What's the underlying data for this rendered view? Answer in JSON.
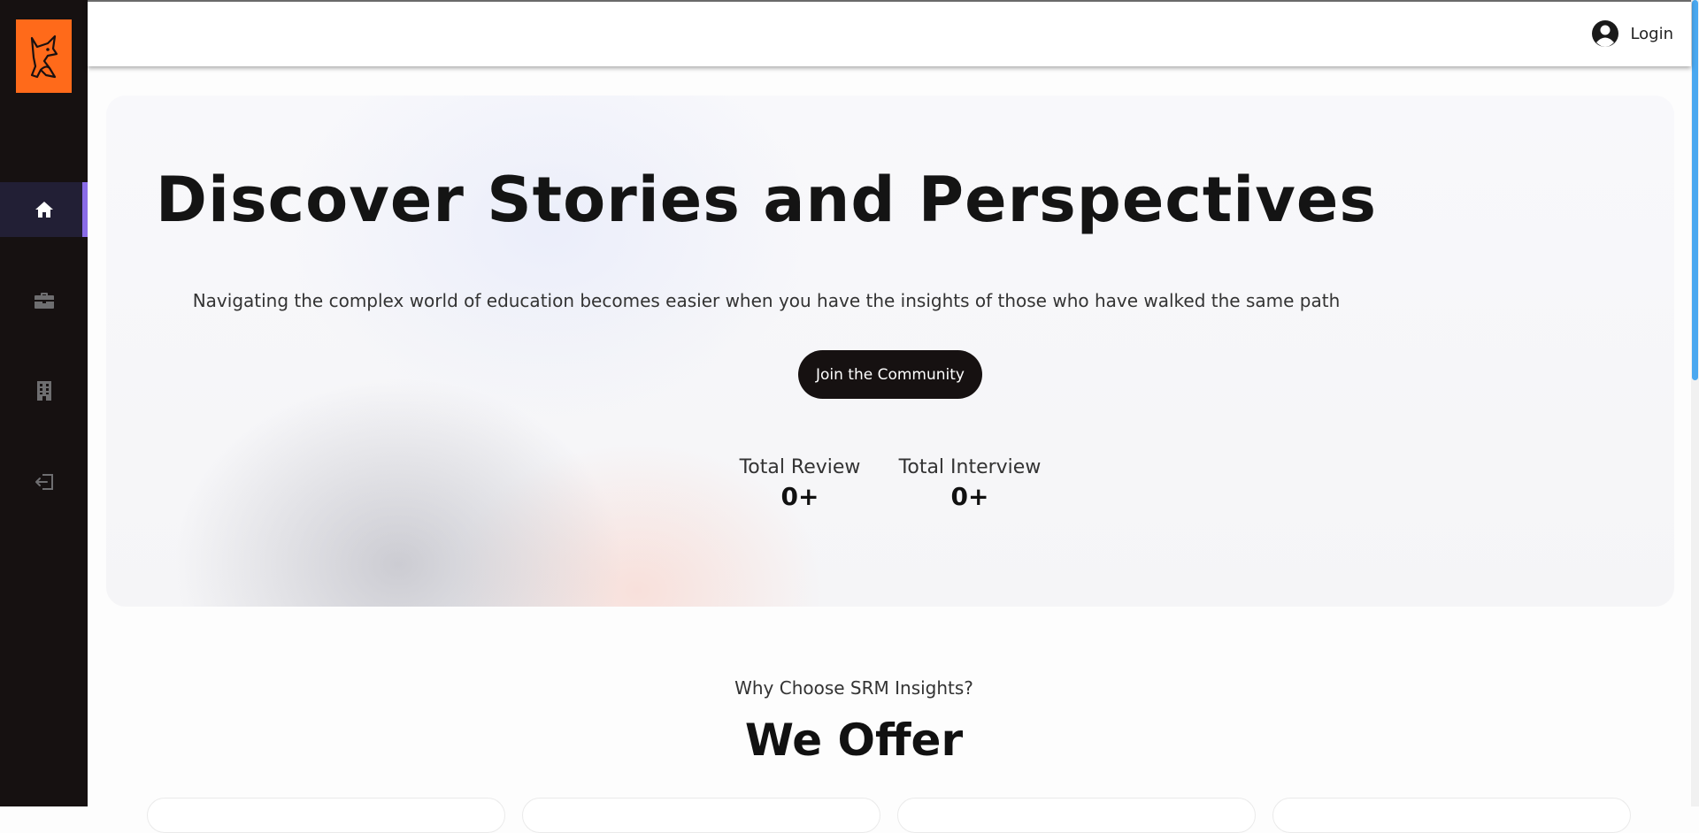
{
  "sidebar": {
    "logo": "fox-logo",
    "items": [
      {
        "icon": "home-icon",
        "active": true
      },
      {
        "icon": "briefcase-icon",
        "active": false
      },
      {
        "icon": "building-icon",
        "active": false
      },
      {
        "icon": "logout-icon",
        "active": false
      }
    ]
  },
  "header": {
    "login_label": "Login"
  },
  "hero": {
    "title": "Discover Stories and Perspectives",
    "subtitle": "Navigating the complex world of education becomes easier when you have the insights of those who have walked the same path",
    "cta_label": "Join the Community",
    "stats": [
      {
        "label": "Total Review",
        "value": "0+"
      },
      {
        "label": "Total Interview",
        "value": "0+"
      }
    ]
  },
  "offer": {
    "eyebrow": "Why Choose SRM Insights?",
    "title": "We Offer"
  },
  "colors": {
    "sidebar_bg": "#161111",
    "logo_bg": "#ff6a1a",
    "active_accent": "#8a6ce8",
    "button_bg": "#161111"
  }
}
